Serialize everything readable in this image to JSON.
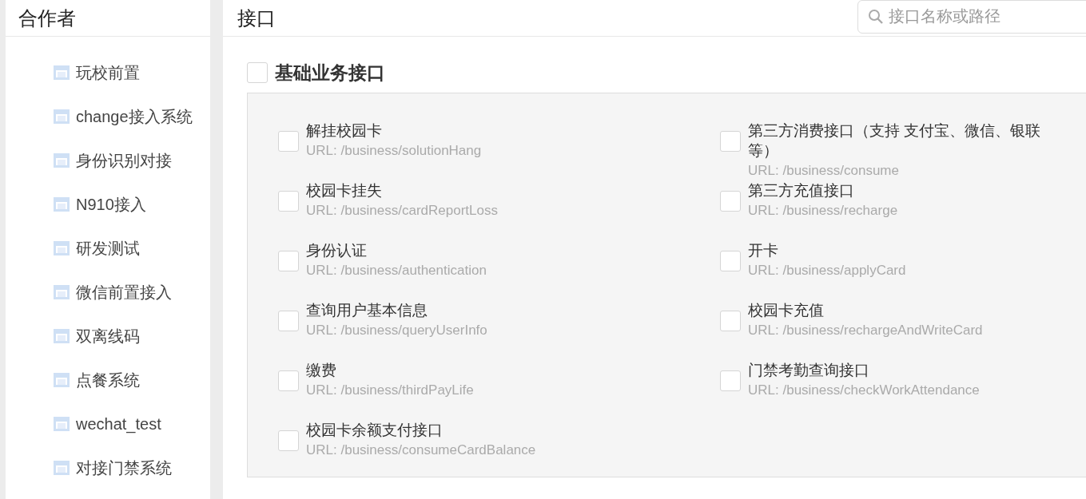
{
  "sidebar": {
    "title": "合作者",
    "items": [
      {
        "label": "玩校前置"
      },
      {
        "label": "change接入系统"
      },
      {
        "label": "身份识别对接"
      },
      {
        "label": "N910接入"
      },
      {
        "label": "研发测试"
      },
      {
        "label": "微信前置接入"
      },
      {
        "label": "双离线码"
      },
      {
        "label": "点餐系统"
      },
      {
        "label": "wechat_test"
      },
      {
        "label": "对接门禁系统"
      }
    ]
  },
  "main": {
    "title": "接口",
    "search": {
      "placeholder": "接口名称或路径"
    },
    "group": {
      "title": "基础业务接口",
      "checked": false,
      "interfaces": [
        {
          "name": "解挂校园卡",
          "url": "URL: /business/solutionHang",
          "checked": false
        },
        {
          "name": "第三方消费接口（支持 支付宝、微信、银联等）",
          "url": "URL: /business/consume",
          "checked": false
        },
        {
          "name": "校园卡挂失",
          "url": "URL: /business/cardReportLoss",
          "checked": false
        },
        {
          "name": "第三方充值接口",
          "url": "URL: /business/recharge",
          "checked": false
        },
        {
          "name": "身份认证",
          "url": "URL: /business/authentication",
          "checked": false
        },
        {
          "name": "开卡",
          "url": "URL: /business/applyCard",
          "checked": false
        },
        {
          "name": "查询用户基本信息",
          "url": "URL: /business/queryUserInfo",
          "checked": false
        },
        {
          "name": "校园卡充值",
          "url": "URL: /business/rechargeAndWriteCard",
          "checked": false
        },
        {
          "name": "缴费",
          "url": "URL: /business/thirdPayLife",
          "checked": false
        },
        {
          "name": "门禁考勤查询接口",
          "url": "URL: /business/checkWorkAttendance",
          "checked": false
        },
        {
          "name": "校园卡余额支付接口",
          "url": "URL: /business/consumeCardBalance",
          "checked": false
        }
      ]
    }
  }
}
